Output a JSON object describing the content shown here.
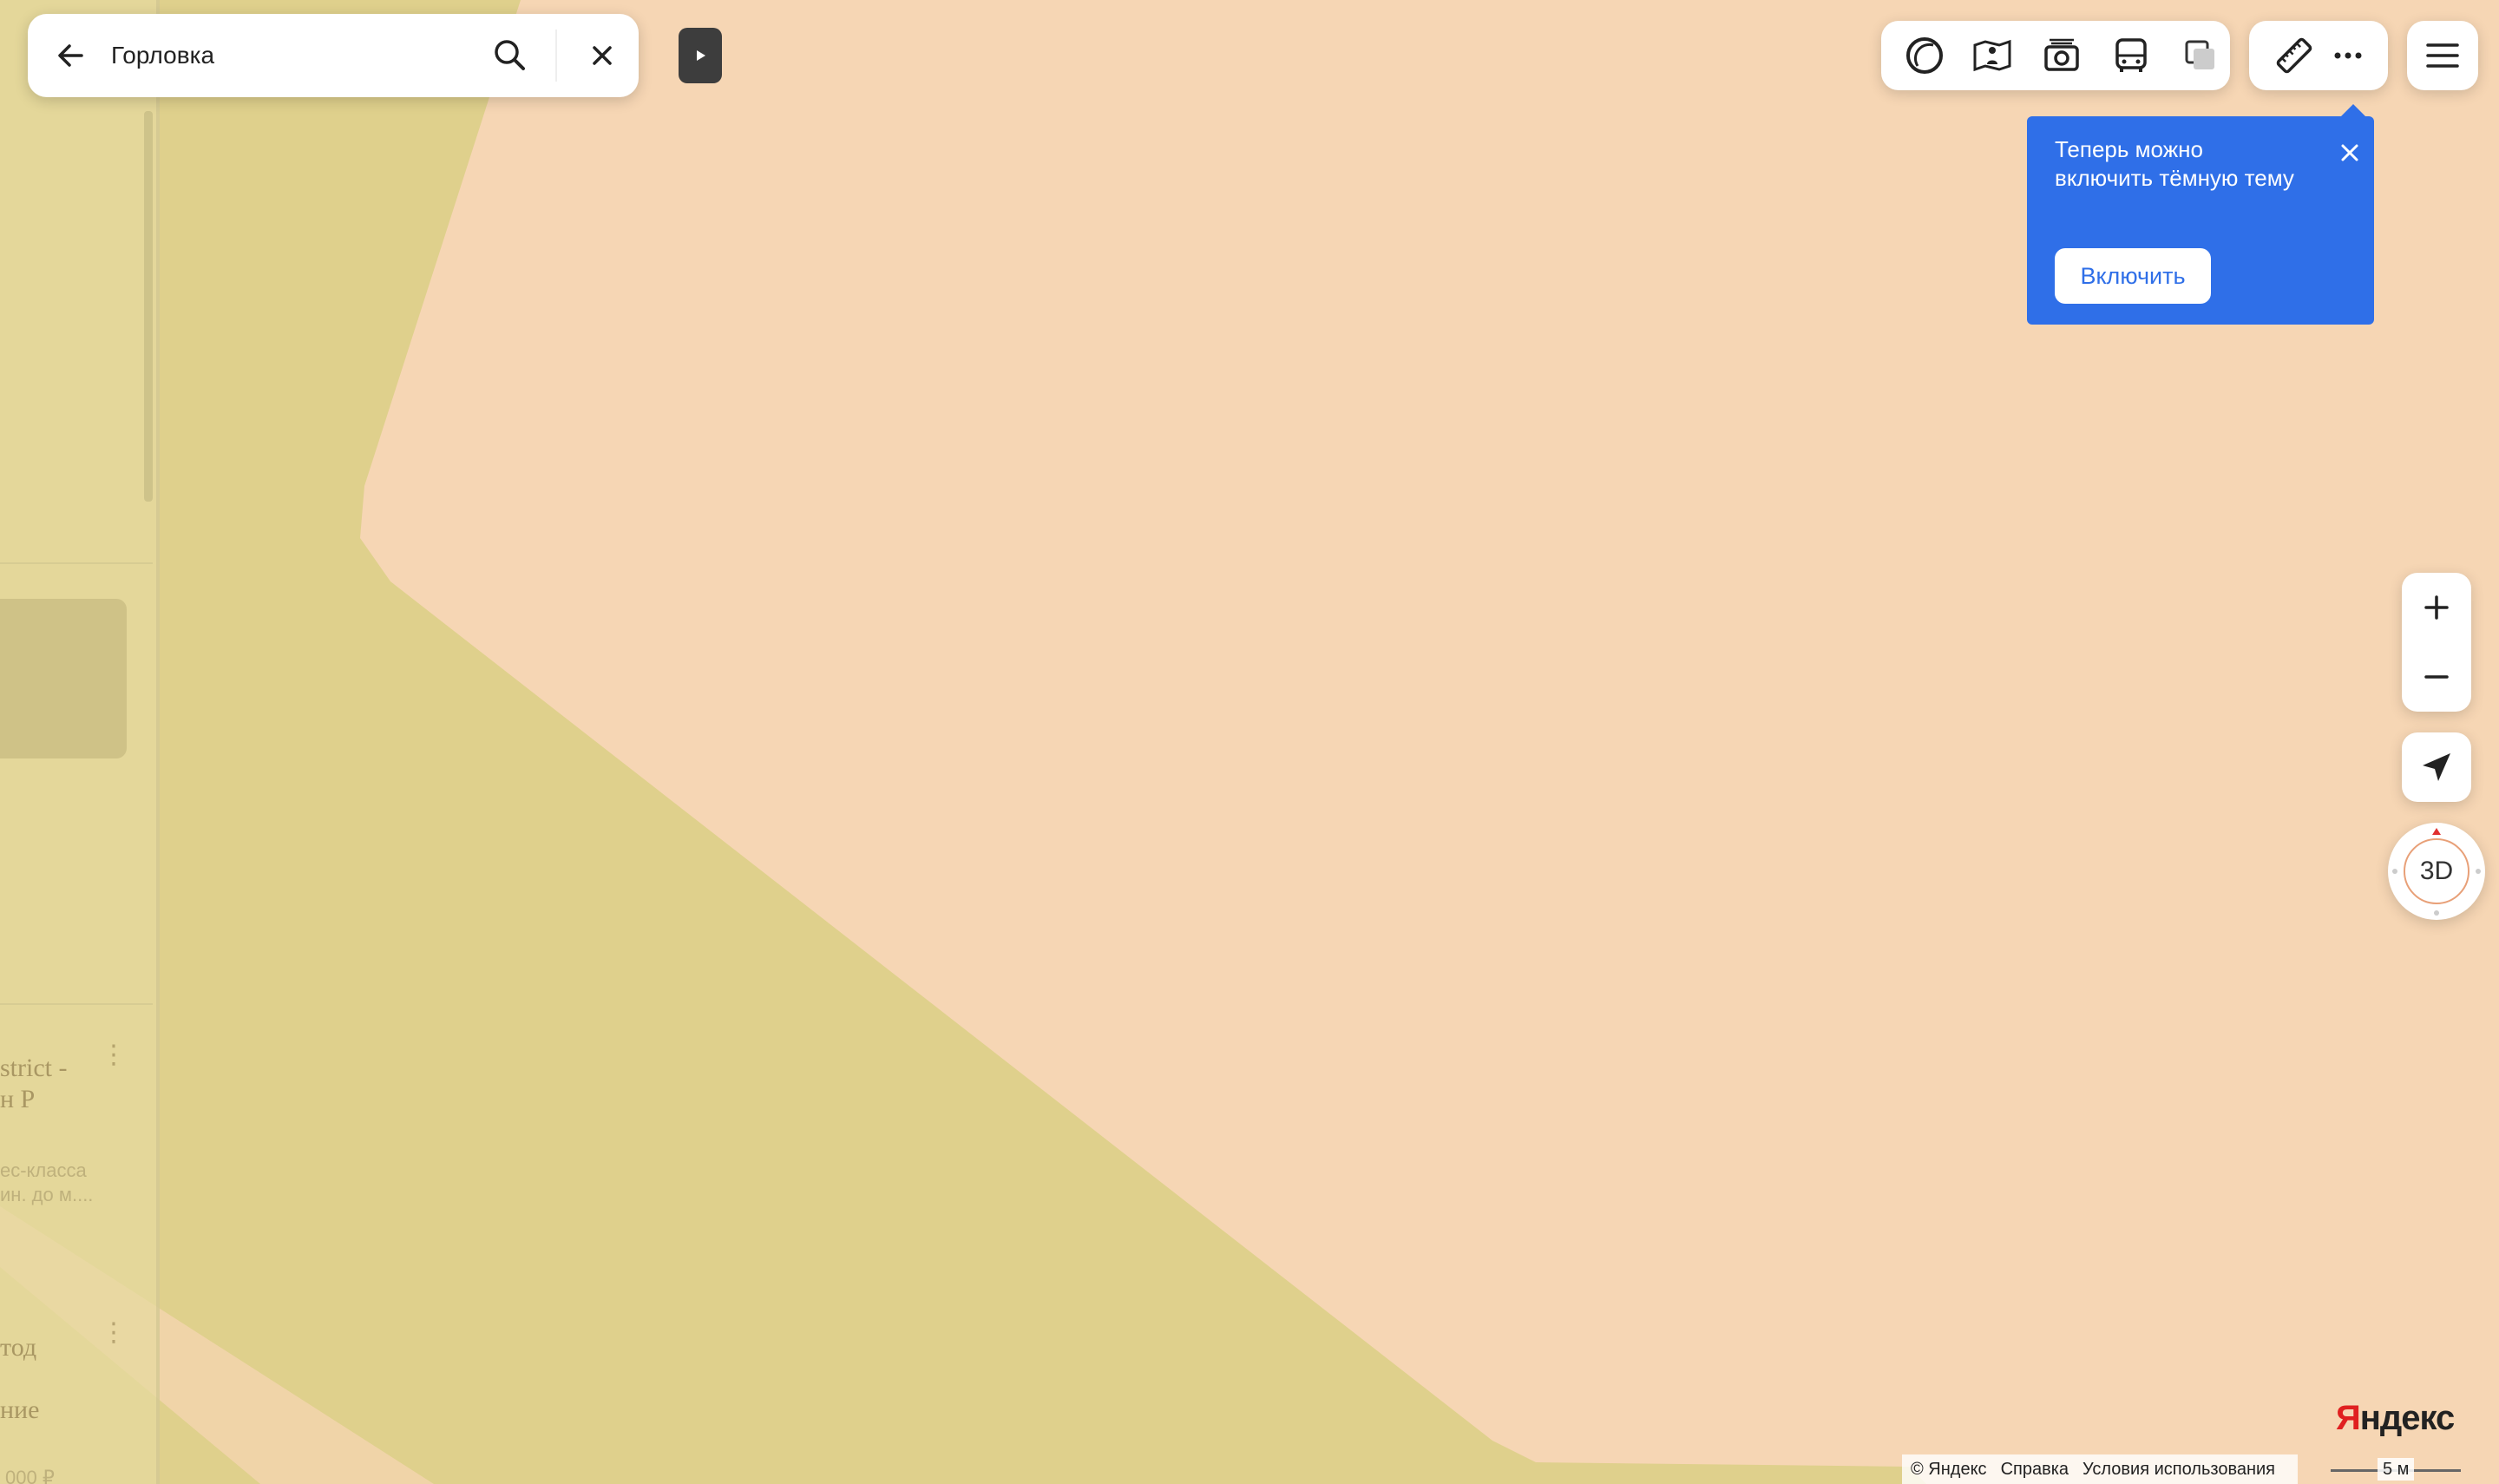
{
  "search": {
    "value": "Горловка"
  },
  "tooltip": {
    "message": "Теперь можно включить тёмную тему",
    "button_label": "Включить"
  },
  "compass": {
    "label": "3D"
  },
  "sidebar": {
    "result_title_line1": "strict -",
    "result_title_line2": "н Р",
    "result_desc_line1": "ес-класса",
    "result_desc_line2": "ин. до м....",
    "item_label_1": "тод",
    "item_label_2": "ние",
    "item_price": "000 ₽"
  },
  "brand": {
    "logo_first": "Я",
    "logo_rest": "ндекс"
  },
  "footer": {
    "copyright": "© Яндекс",
    "help": "Справка",
    "terms": "Условия использования"
  },
  "scale": {
    "label": "5 м"
  },
  "colors": {
    "map_background": "#f6d6b4",
    "area_fill": "#dfd08c",
    "accent": "#2f6fe8",
    "logo_red": "#e02020"
  }
}
